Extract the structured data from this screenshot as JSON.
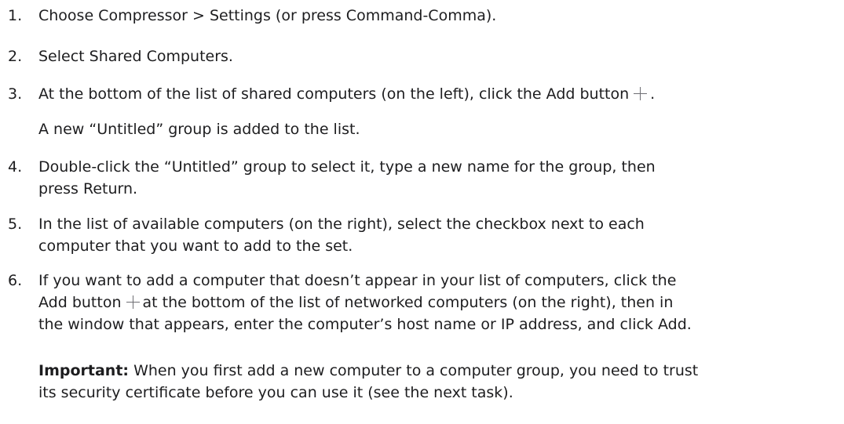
{
  "steps": [
    {
      "number": "1.",
      "text": "Choose Compressor > Settings (or press Command-Comma)."
    },
    {
      "number": "2.",
      "text": "Select Shared Computers."
    },
    {
      "number": "3.",
      "before_icon": "At the bottom of the list of shared computers (on the left), click the Add button",
      "after_icon": ".",
      "icon": "add-plus-icon",
      "note": "A new “Untitled” group is added to the list."
    },
    {
      "number": "4.",
      "line1": "Double-click the “Untitled” group to select it, type a new name for the group, then",
      "line2": "press Return."
    },
    {
      "number": "5.",
      "line1": "In the list of available computers (on the right), select the checkbox next to each",
      "line2": "computer that you want to add to the set."
    },
    {
      "number": "6.",
      "line1": "If you want to add a computer that doesn’t appear in your list of computers, click the",
      "line2_before_icon": "Add button",
      "line2_after_icon": "at the bottom of the list of networked computers (on the right), then in",
      "line3": "the window that appears, enter the computer’s host name or IP address, and click Add.",
      "icon": "add-plus-icon"
    }
  ],
  "important": {
    "label": "Important:",
    "line1": "When you first add a new computer to a computer group, you need to trust",
    "line2": "its security certificate before you can use it (see the next task)."
  }
}
